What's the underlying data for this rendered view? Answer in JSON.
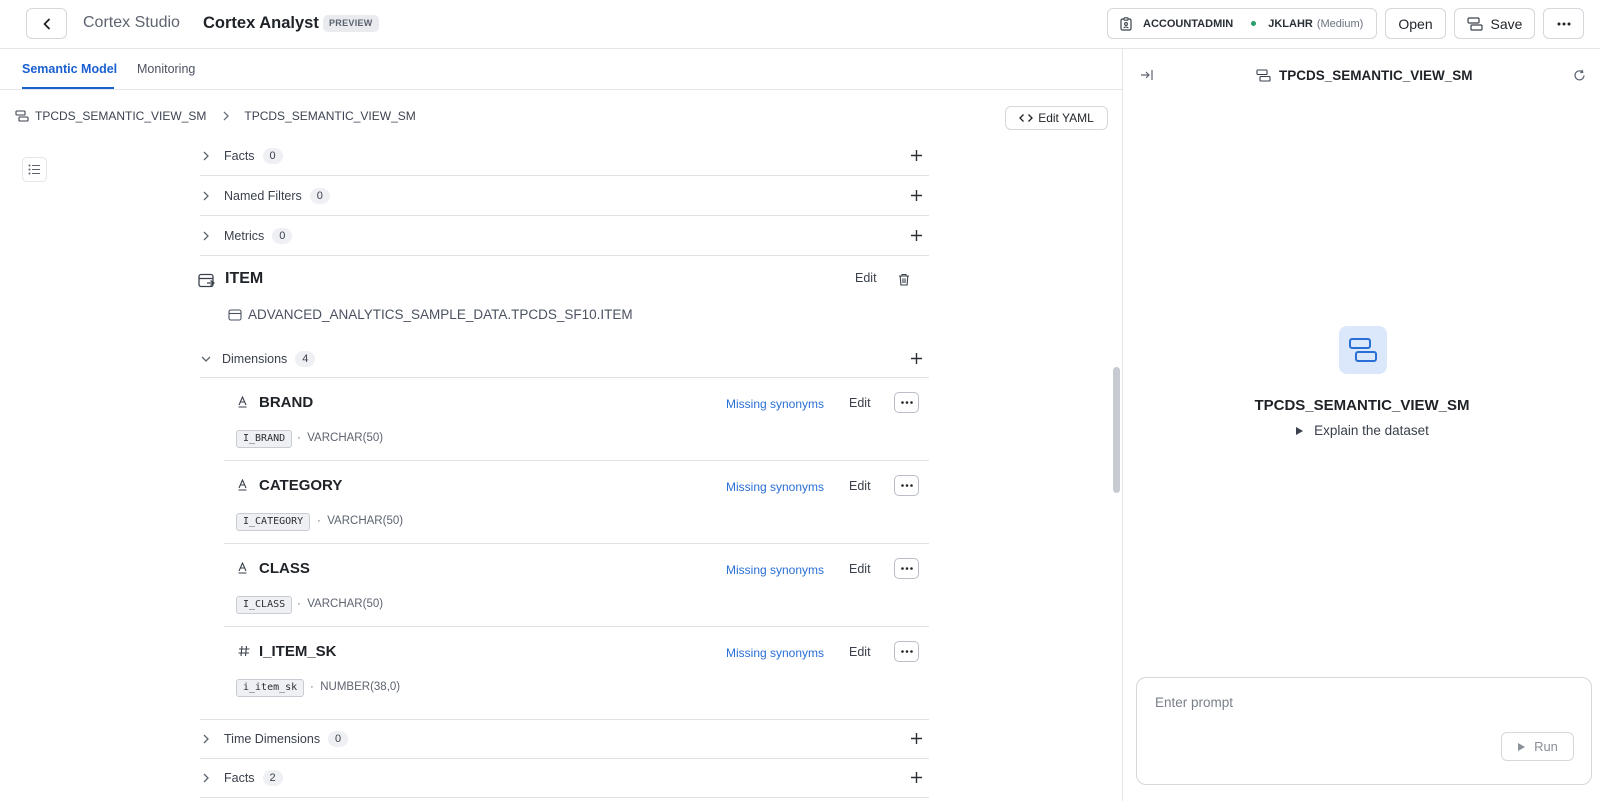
{
  "header": {
    "studio": "Cortex Studio",
    "title": "Cortex Analyst",
    "badge": "PREVIEW",
    "role": "ACCOUNTADMIN",
    "warehouse": "JKLAHR",
    "warehouse_size": "(Medium)",
    "open_label": "Open",
    "save_label": "Save"
  },
  "tabs": [
    "Semantic Model",
    "Monitoring"
  ],
  "breadcrumb": [
    "TPCDS_SEMANTIC_VIEW_SM",
    "TPCDS_SEMANTIC_VIEW_SM"
  ],
  "edit_yaml_label": "Edit YAML",
  "top_sections": [
    {
      "label": "Facts",
      "count": "0"
    },
    {
      "label": "Named Filters",
      "count": "0"
    },
    {
      "label": "Metrics",
      "count": "0"
    }
  ],
  "table": {
    "name": "ITEM",
    "edit": "Edit",
    "path": "ADVANCED_ANALYTICS_SAMPLE_DATA.TPCDS_SF10.ITEM",
    "dimensions_label": "Dimensions",
    "dimensions_count": "4",
    "dimensions": [
      {
        "icon": "text-type-icon",
        "name": "BRAND",
        "column": "I_BRAND",
        "type": "VARCHAR(50)",
        "missing": "Missing synonyms",
        "edit": "Edit"
      },
      {
        "icon": "text-type-icon",
        "name": "CATEGORY",
        "column": "I_CATEGORY",
        "type": "VARCHAR(50)",
        "missing": "Missing synonyms",
        "edit": "Edit"
      },
      {
        "icon": "text-type-icon",
        "name": "CLASS",
        "column": "I_CLASS",
        "type": "VARCHAR(50)",
        "missing": "Missing synonyms",
        "edit": "Edit"
      },
      {
        "icon": "number-type-icon",
        "name": "I_ITEM_SK",
        "column": "i_item_sk",
        "type": "NUMBER(38,0)",
        "missing": "Missing synonyms",
        "edit": "Edit"
      }
    ],
    "bottom_sections": [
      {
        "label": "Time Dimensions",
        "count": "0"
      },
      {
        "label": "Facts",
        "count": "2"
      }
    ]
  },
  "right_panel": {
    "title": "TPCDS_SEMANTIC_VIEW_SM",
    "center_name": "TPCDS_SEMANTIC_VIEW_SM",
    "explain": "Explain the dataset",
    "prompt_placeholder": "Enter prompt",
    "run_label": "Run"
  }
}
